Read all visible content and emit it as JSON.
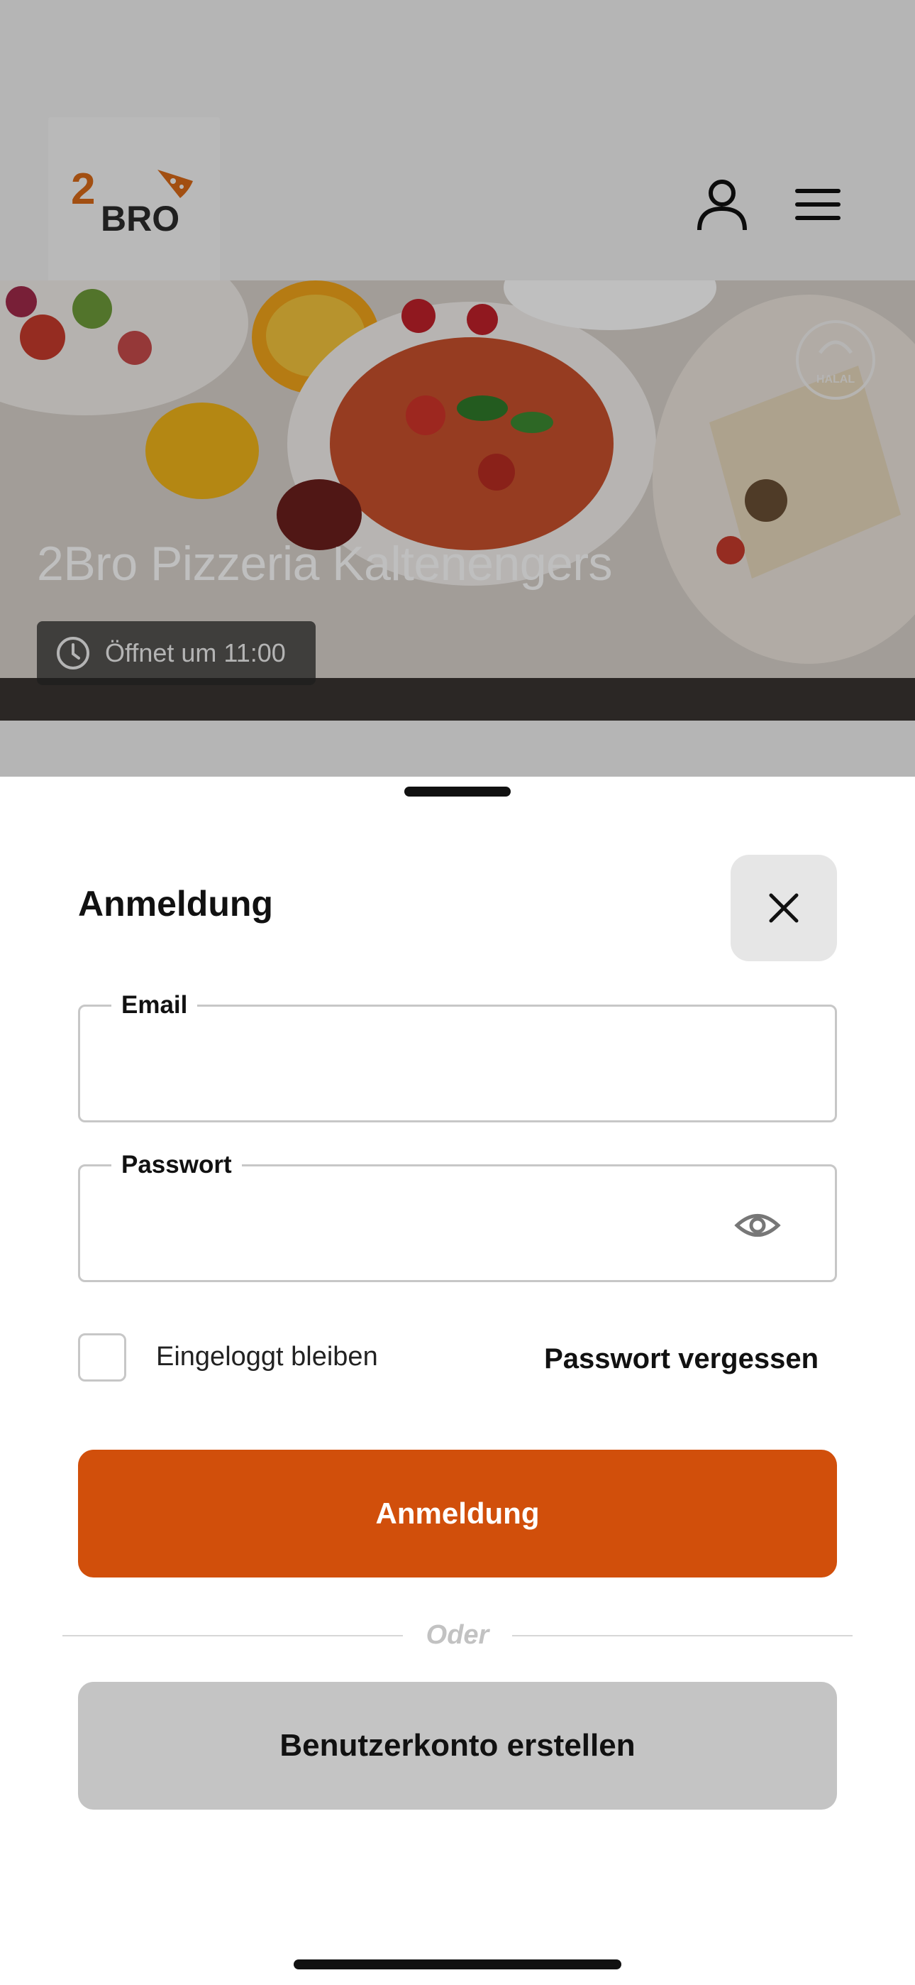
{
  "header": {
    "logo_text_number": "2",
    "logo_text_word": "BRO",
    "brand_color": "#d96a18",
    "user_icon": "user-icon",
    "menu_icon": "menu-icon"
  },
  "hero": {
    "restaurant_name": "2Bro Pizzeria Kaltenengers",
    "opening_status": "Öffnet um 11:00",
    "badge_text": "HALAL",
    "clock_icon": "clock-icon"
  },
  "login_sheet": {
    "title": "Anmeldung",
    "close_icon": "close-icon",
    "email_label": "Email",
    "email_value": "",
    "password_label": "Passwort",
    "password_value": "",
    "password_toggle_icon": "eye-icon",
    "remember_label": "Eingeloggt bleiben",
    "remember_checked": false,
    "forgot_password": "Passwort vergessen",
    "submit_label": "Anmeldung",
    "divider_text": "Oder",
    "create_account_label": "Benutzerkonto erstellen",
    "accent_color": "#d14f0b"
  }
}
